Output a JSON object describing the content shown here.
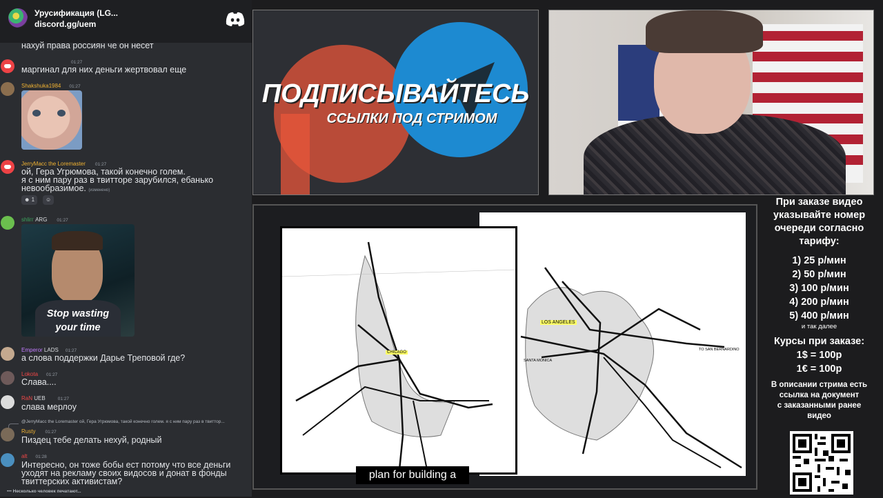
{
  "server": {
    "name": "Урусификация (LG...",
    "link": "discord.gg/uem"
  },
  "messages": [
    {
      "text": "нахуй права россиян че он несет"
    },
    {
      "name": "",
      "time": "01:27",
      "text": "маргинал для них деньги жертвовал еще"
    },
    {
      "name": "Shakshuka1984",
      "time": "01:27"
    },
    {
      "name": "JerryMacc the Loremaster",
      "time": "01:27",
      "lines": [
        "ой, Гера Угрюмова, такой конечно голем.",
        "я с ним пару раз в твитторе зарубился, ебанько",
        "невообразимое."
      ],
      "edited": "(изменено)",
      "reaction_count": "1"
    },
    {
      "name": "shliгг",
      "tag": "ARG",
      "time": "01:27",
      "gif_caption_1": "Stop wasting",
      "gif_caption_2": "your time"
    },
    {
      "name": "Emperor",
      "tag": "LADS",
      "time": "01:27",
      "text": "а слова поддержки Дарье Треповой где?"
    },
    {
      "name": "Lokota",
      "time": "01:27",
      "text": "Слава...."
    },
    {
      "name": "RaN",
      "tag": "UEB",
      "time": "01:27",
      "text": "слава мерлоу"
    },
    {
      "reply": "@JerryMacc the Loremaster ой, Гера Угрюмова, такой конечно голем. я с ним пару раз в твиттор...",
      "name": "Rusty",
      "time": "01:27",
      "text": "Пиздец тебе делать нехуй, родный"
    },
    {
      "name": "alt",
      "time": "01:28",
      "lines": [
        "Интересно, он тоже бобы ест потому что все деньги",
        "уходят на рекламу своих видосов и донат в фонды",
        "твиттерских активистам?"
      ]
    }
  ],
  "typing": "Несколько человек печатают...",
  "ad": {
    "title": "ПОДПИСЫВАЙТЕСЬ",
    "subtitle": "ССЫЛКИ ПОД СТРИМОМ"
  },
  "subtitle_caption": "plan for building a",
  "maps": {
    "left_label": "CHICAGO",
    "right_label": "LOS ANGELES",
    "right_to_sb": "TO SAN BERNARDINO",
    "right_santa": "SANTA MONICA"
  },
  "info": {
    "order": [
      "При заказе видео",
      "указывайте номер",
      "очереди согласно",
      "тарифу:"
    ],
    "tariffs": [
      "1) 25 р/мин",
      "2) 50 р/мин",
      "3) 100 р/мин",
      "4) 200 р/мин",
      "5) 400 р/мин"
    ],
    "etc": "и так далее",
    "rates_title": "Курсы при заказе:",
    "rates": [
      "1$ = 100р",
      "1€ = 100р"
    ],
    "desc": [
      "В описании стрима есть",
      "ссылка на документ",
      "с заказанными ранее",
      "видео"
    ]
  },
  "colors": {
    "discord_bg": "#2b2d31",
    "header_bg": "#1e1f22",
    "name_orange": "#f0b232",
    "name_green": "#3ba55d",
    "name_purple": "#c27cff",
    "name_red": "#f04747"
  }
}
